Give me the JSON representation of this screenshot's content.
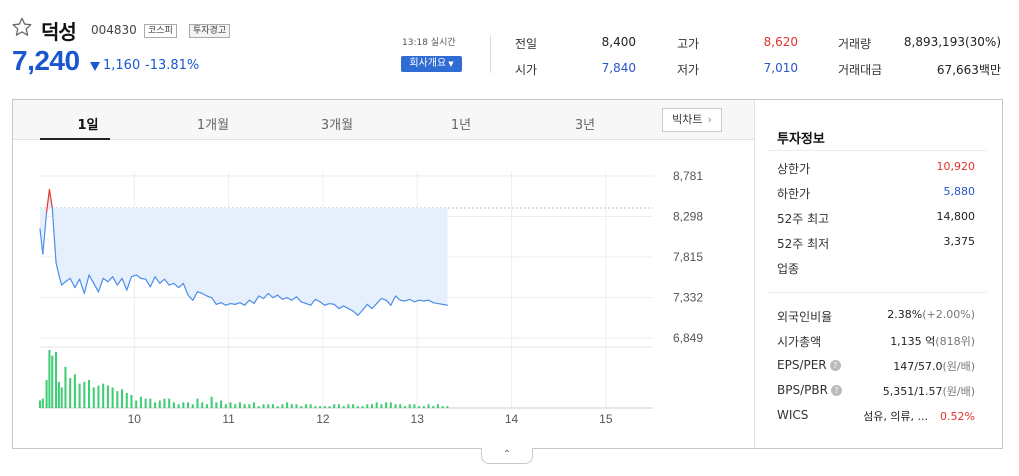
{
  "stock": {
    "name": "덕성",
    "code": "004830",
    "market_tag": "코스피",
    "warning_tag": "투자경고",
    "price": "7,240",
    "change": "1,160",
    "change_pct": "-13.81%",
    "direction": "down"
  },
  "meta": {
    "realtime_label": "13:18 실시간",
    "company_button": "회사개요"
  },
  "quote": [
    {
      "label": "전일",
      "value": "8,400",
      "color": "#222222"
    },
    {
      "label": "시가",
      "value": "7,840",
      "color": "#2d55c9"
    },
    {
      "label": "고가",
      "value": "8,620",
      "color": "#e4322d"
    },
    {
      "label": "저가",
      "value": "7,010",
      "color": "#2d55c9"
    },
    {
      "label": "거래량",
      "value": "8,893,193(30%)",
      "color": "#222222"
    },
    {
      "label": "거래대금",
      "value": "67,663백만",
      "color": "#222222"
    }
  ],
  "tabs": [
    "1일",
    "1개월",
    "3개월",
    "1년",
    "3년"
  ],
  "active_tab": "1일",
  "big_chart_button": "빅차트",
  "colors": {
    "up": "#e4322d",
    "down": "#1957d1",
    "area_fill": "#e6f0fc",
    "line": "#4d8ee6",
    "volume": "#3dcc73"
  },
  "chart_data": {
    "type": "line",
    "title": "",
    "xlabel": "",
    "ylabel": "",
    "x_ticks": [
      "10",
      "11",
      "12",
      "13",
      "14",
      "15"
    ],
    "y_ticks": [
      "8,781",
      "8,298",
      "7,815",
      "7,332",
      "6,849"
    ],
    "ylim": [
      6849,
      8781
    ],
    "prev_close": 8400,
    "x_range_hours": [
      9.0,
      15.5
    ],
    "grid": true,
    "series": [
      {
        "x": [
          9.0,
          9.03,
          9.07,
          9.1,
          9.13,
          9.17,
          9.2,
          9.23,
          9.27,
          9.32,
          9.37,
          9.42,
          9.47,
          9.52,
          9.57,
          9.62,
          9.67,
          9.72,
          9.77,
          9.82,
          9.87,
          9.92,
          9.97,
          10.02,
          10.07,
          10.12,
          10.17,
          10.22,
          10.27,
          10.32,
          10.37,
          10.42,
          10.47,
          10.52,
          10.57,
          10.62,
          10.67,
          10.72,
          10.77,
          10.82,
          10.87,
          10.92,
          10.97,
          11.02,
          11.07,
          11.12,
          11.17,
          11.22,
          11.27,
          11.32,
          11.37,
          11.42,
          11.47,
          11.52,
          11.57,
          11.62,
          11.67,
          11.72,
          11.77,
          11.82,
          11.87,
          11.92,
          11.97,
          12.02,
          12.07,
          12.12,
          12.17,
          12.22,
          12.27,
          12.32,
          12.37,
          12.42,
          12.47,
          12.52,
          12.57,
          12.62,
          12.67,
          12.72,
          12.77,
          12.82,
          12.87,
          12.92,
          12.97,
          13.02,
          13.07,
          13.12,
          13.17,
          13.22,
          13.27,
          13.32
        ],
        "values": [
          8150,
          7850,
          8350,
          8620,
          8400,
          7750,
          7600,
          7480,
          7520,
          7560,
          7450,
          7550,
          7380,
          7600,
          7500,
          7400,
          7560,
          7520,
          7580,
          7480,
          7560,
          7420,
          7580,
          7600,
          7560,
          7550,
          7460,
          7580,
          7500,
          7550,
          7480,
          7500,
          7450,
          7500,
          7360,
          7300,
          7400,
          7380,
          7350,
          7330,
          7250,
          7270,
          7240,
          7260,
          7250,
          7270,
          7240,
          7300,
          7260,
          7350,
          7320,
          7380,
          7330,
          7360,
          7310,
          7330,
          7300,
          7340,
          7280,
          7260,
          7240,
          7310,
          7280,
          7240,
          7260,
          7250,
          7200,
          7230,
          7200,
          7170,
          7120,
          7180,
          7250,
          7200,
          7260,
          7320,
          7300,
          7240,
          7350,
          7300,
          7290,
          7310,
          7280,
          7300,
          7290,
          7300,
          7270,
          7260,
          7250,
          7240
        ]
      }
    ],
    "volume": [
      4,
      5,
      15,
      31,
      28,
      30,
      14,
      11,
      22,
      16,
      18,
      13,
      14,
      15,
      11,
      12,
      13,
      12,
      11,
      9,
      10,
      8,
      7,
      4,
      6,
      5,
      5,
      3,
      4,
      5,
      5,
      3,
      2,
      3,
      3,
      2,
      5,
      3,
      2,
      6,
      3,
      4,
      2,
      3,
      2,
      3,
      2,
      2,
      3,
      1,
      2,
      2,
      2,
      1,
      2,
      3,
      2,
      2,
      1,
      2,
      2,
      1,
      1,
      1,
      1,
      2,
      2,
      1,
      2,
      2,
      1,
      1,
      2,
      2,
      3,
      2,
      3,
      3,
      2,
      2,
      1,
      2,
      2,
      1,
      1,
      2,
      1,
      2,
      1,
      1
    ]
  },
  "info": {
    "title": "투자정보",
    "rows": [
      {
        "label": "상한가",
        "value": "10,920",
        "sub": "",
        "color": "#e4322d"
      },
      {
        "label": "하한가",
        "value": "5,880",
        "sub": "",
        "color": "#2d55c9"
      },
      {
        "label": "52주 최고",
        "value": "14,800",
        "sub": "",
        "color": "#222222"
      },
      {
        "label": "52주 최저",
        "value": "3,375",
        "sub": "",
        "color": "#222222"
      },
      {
        "label": "업종",
        "value": "",
        "sub": "",
        "color": "#222222"
      }
    ],
    "rows2": [
      {
        "label": "외국인비율",
        "value": "2.38%",
        "sub": "(+2.00%)",
        "color": "#222222",
        "help": false
      },
      {
        "label": "시가총액",
        "value": "1,135 억",
        "sub": "(818위)",
        "color": "#222222",
        "help": false
      },
      {
        "label": "EPS/PER",
        "value": "147/57.0",
        "sub": "(원/배)",
        "color": "#222222",
        "help": true
      },
      {
        "label": "BPS/PBR",
        "value": "5,351/1.57",
        "sub": "(원/배)",
        "color": "#222222",
        "help": true
      },
      {
        "label": "WICS",
        "value": "섬유, 의류, ...",
        "sub": "",
        "color": "#222222",
        "help": false,
        "extra": "0.52%",
        "extra_color": "#e4322d"
      }
    ],
    "help_mark": "?"
  },
  "fold_icon": "chevron-up-icon",
  "fold_glyph": "⌃"
}
